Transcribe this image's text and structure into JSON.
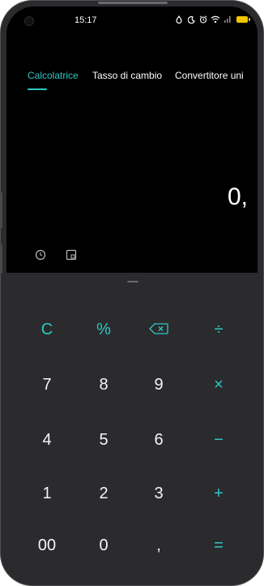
{
  "status_bar": {
    "time": "15:17",
    "icons": [
      "water-drop-icon",
      "moon-icon",
      "alarm-icon",
      "wifi-icon",
      "signal-icon",
      "battery-icon"
    ],
    "battery_color": "#f2c500"
  },
  "tabs": [
    {
      "label": "Calcolatrice",
      "active": true
    },
    {
      "label": "Tasso di cambio",
      "active": false
    },
    {
      "label": "Convertitore uni",
      "active": false
    }
  ],
  "display": {
    "value": "0,"
  },
  "tools": [
    "history-icon",
    "scientific-mode-icon"
  ],
  "keypad": {
    "rows": [
      [
        "C",
        "%",
        "backspace-icon",
        "÷"
      ],
      [
        "7",
        "8",
        "9",
        "×"
      ],
      [
        "4",
        "5",
        "6",
        "−"
      ],
      [
        "1",
        "2",
        "3",
        "+"
      ],
      [
        "00",
        "0",
        ",",
        "="
      ]
    ]
  },
  "colors": {
    "accent": "#2cc9c4",
    "keypad_bg": "#2b2b2e",
    "screen_bg": "#000000"
  }
}
